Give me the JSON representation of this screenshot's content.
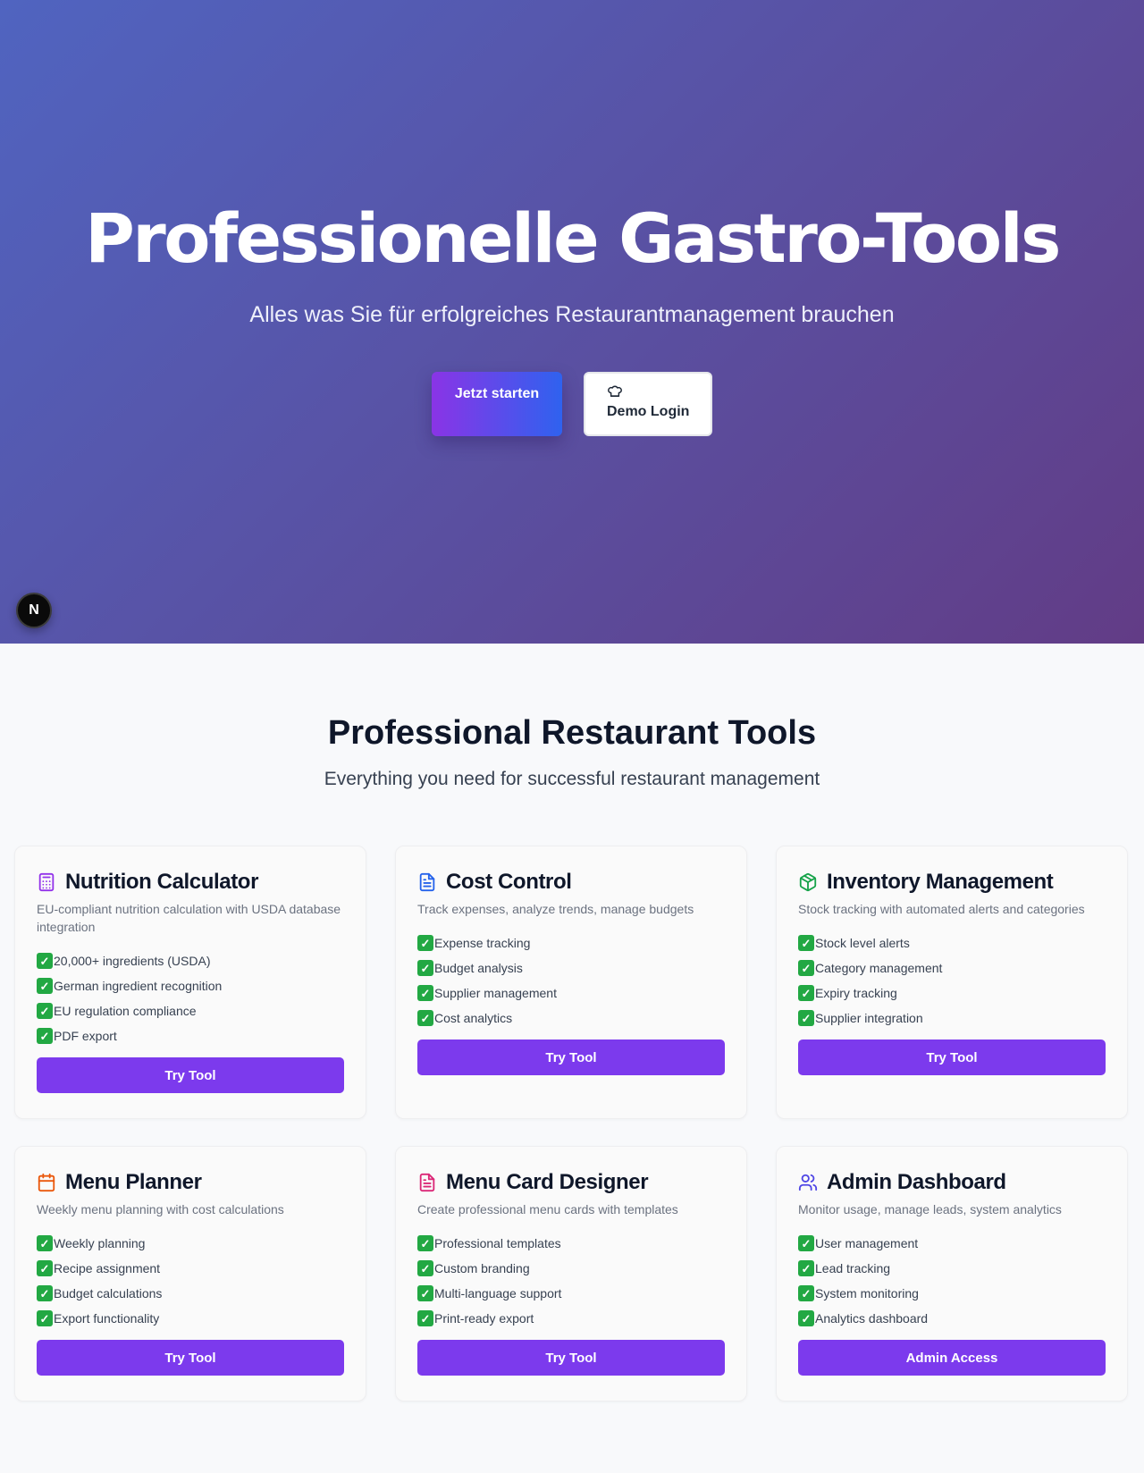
{
  "hero": {
    "title": "Professionelle Gastro-Tools",
    "subtitle": "Alles was Sie für erfolgreiches Restaurantmanagement brauchen",
    "start_button": "Jetzt starten",
    "demo_button": "Demo Login",
    "demo_icon": "chef-hat-icon",
    "badge_letter": "N",
    "gradient_colors": [
      "#5064c0",
      "#623c86"
    ]
  },
  "tools": {
    "title": "Professional Restaurant Tools",
    "subtitle": "Everything you need for successful restaurant management",
    "accent_color": "#7c3aed",
    "cards": [
      {
        "title": "Nutrition Calculator",
        "icon": "calculator-icon",
        "icon_color": "#9333ea",
        "description": "EU-compliant nutrition calculation with USDA database integration",
        "features": [
          "20,000+ ingredients (USDA)",
          "German ingredient recognition",
          "EU regulation compliance",
          "PDF export"
        ],
        "button": "Try Tool"
      },
      {
        "title": "Cost Control",
        "icon": "document-icon",
        "icon_color": "#2563eb",
        "description": "Track expenses, analyze trends, manage budgets",
        "features": [
          "Expense tracking",
          "Budget analysis",
          "Supplier management",
          "Cost analytics"
        ],
        "button": "Try Tool"
      },
      {
        "title": "Inventory Management",
        "icon": "package-icon",
        "icon_color": "#16a34a",
        "description": "Stock tracking with automated alerts and categories",
        "features": [
          "Stock level alerts",
          "Category management",
          "Expiry tracking",
          "Supplier integration"
        ],
        "button": "Try Tool"
      },
      {
        "title": "Menu Planner",
        "icon": "calendar-icon",
        "icon_color": "#ea580c",
        "description": "Weekly menu planning with cost calculations",
        "features": [
          "Weekly planning",
          "Recipe assignment",
          "Budget calculations",
          "Export functionality"
        ],
        "button": "Try Tool"
      },
      {
        "title": "Menu Card Designer",
        "icon": "file-text-icon",
        "icon_color": "#db2777",
        "description": "Create professional menu cards with templates",
        "features": [
          "Professional templates",
          "Custom branding",
          "Multi-language support",
          "Print-ready export"
        ],
        "button": "Try Tool"
      },
      {
        "title": "Admin Dashboard",
        "icon": "users-icon",
        "icon_color": "#4f46e5",
        "description": "Monitor usage, manage leads, system analytics",
        "features": [
          "User management",
          "Lead tracking",
          "System monitoring",
          "Analytics dashboard"
        ],
        "button": "Admin Access"
      }
    ]
  }
}
